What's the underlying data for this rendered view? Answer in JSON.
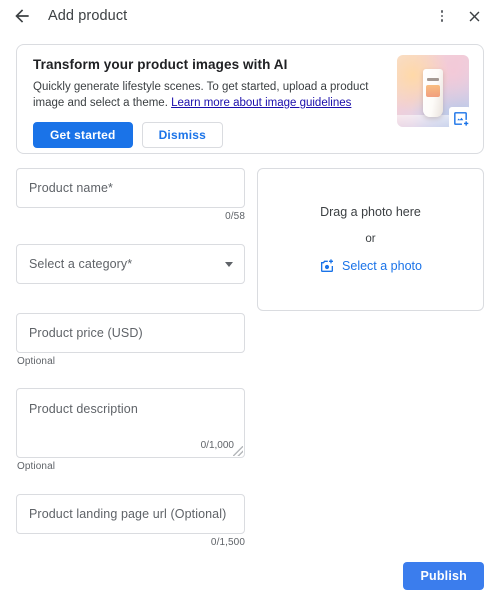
{
  "header": {
    "back_icon": "arrow-left-icon",
    "title": "Add product",
    "menu_icon": "more-vert-icon",
    "close_icon": "close-icon"
  },
  "promo": {
    "title": "Transform your product images with AI",
    "body_part1": "Quickly generate lifestyle scenes. To get started, upload a product image and select a theme.",
    "link_text": "Learn more about image guidelines",
    "primary_label": "Get started",
    "secondary_label": "Dismiss",
    "thumbnail_badge_icon": "add-photo-icon"
  },
  "form": {
    "product_name": {
      "placeholder": "Product name*",
      "value": "",
      "counter": "0/58"
    },
    "category": {
      "placeholder": "Select a category*",
      "value": "",
      "caret_icon": "chevron-down-icon"
    },
    "product_price": {
      "placeholder": "Product price (USD)",
      "value": "",
      "helper": "Optional"
    },
    "product_description": {
      "placeholder": "Product description",
      "value": "",
      "counter": "0/1,000",
      "helper": "Optional"
    },
    "landing_page_url": {
      "placeholder": "Product landing page url (Optional)",
      "value": "",
      "counter": "0/1,500"
    }
  },
  "dropzone": {
    "line1": "Drag a photo here",
    "or": "or",
    "select_label": "Select a photo",
    "select_icon": "add-a-photo-icon"
  },
  "footer": {
    "publish_label": "Publish"
  },
  "colors": {
    "accent_blue": "#1a73e8",
    "publish_blue": "#3b7ded",
    "link_blue": "#1a0dab",
    "border_gray": "#dadce0",
    "text_primary": "#202124",
    "text_secondary": "#5f6368"
  }
}
